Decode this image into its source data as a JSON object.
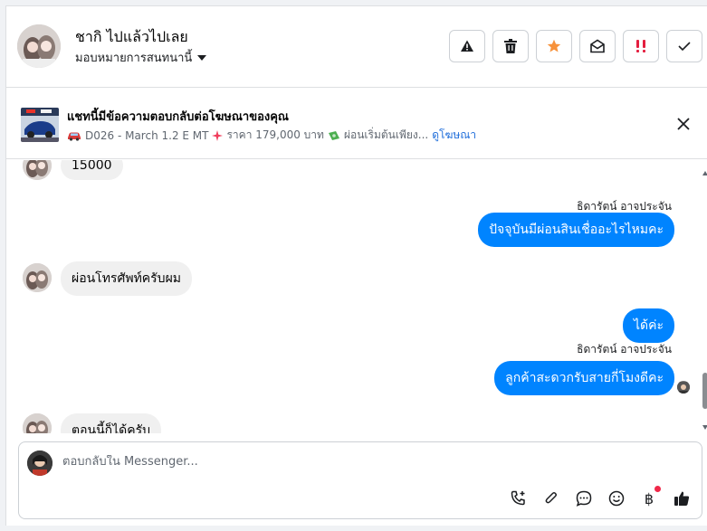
{
  "header": {
    "contact_name": "ชากิ ไปแล้วไปเลย",
    "assign_label": "มอบหมายการสนทนานี้",
    "actions": [
      {
        "name": "report-button",
        "icon": "warning-icon"
      },
      {
        "name": "delete-button",
        "icon": "trash-icon"
      },
      {
        "name": "star-button",
        "icon": "star-icon"
      },
      {
        "name": "mark-unread-button",
        "icon": "envelope-open-icon"
      },
      {
        "name": "priority-button",
        "icon": "double-exclamation-icon"
      },
      {
        "name": "done-button",
        "icon": "check-icon"
      }
    ]
  },
  "ad_banner": {
    "title": "แชทนี้มีข้อความตอบกลับต่อโฆษณาของคุณ",
    "product": "D026 - March 1.2 E MT",
    "price": "ราคา 179,000 บาท",
    "installment": "ผ่อนเริ่มต้นเพียง...",
    "link": "ดูโฆษณา"
  },
  "messages": [
    {
      "dir": "in",
      "text": "15000"
    },
    {
      "dir": "out",
      "sender": "ธิดารัตน์ อาจประจัน",
      "text": "ปัจจุบันมีผ่อนสินเชื่ออะไรไหมคะ"
    },
    {
      "dir": "in",
      "text": "ผ่อนโทรศัพท์ครับผม"
    },
    {
      "dir": "out",
      "text": "ได้ค่ะ"
    },
    {
      "dir": "out",
      "sender": "ธิดารัตน์ อาจประจัน",
      "text": "ลูกค้าสะดวกรับสายกี่โมงดีคะ"
    },
    {
      "dir": "in",
      "text": "ตอนนี้ก็ได้ครับ"
    }
  ],
  "composer": {
    "placeholder": "ตอบกลับใน Messenger...",
    "baht_symbol": "฿"
  },
  "colors": {
    "accent": "#0084ff",
    "incoming_bubble": "#f0f0f0",
    "star": "#f7923b",
    "priority": "#e41e3f"
  }
}
